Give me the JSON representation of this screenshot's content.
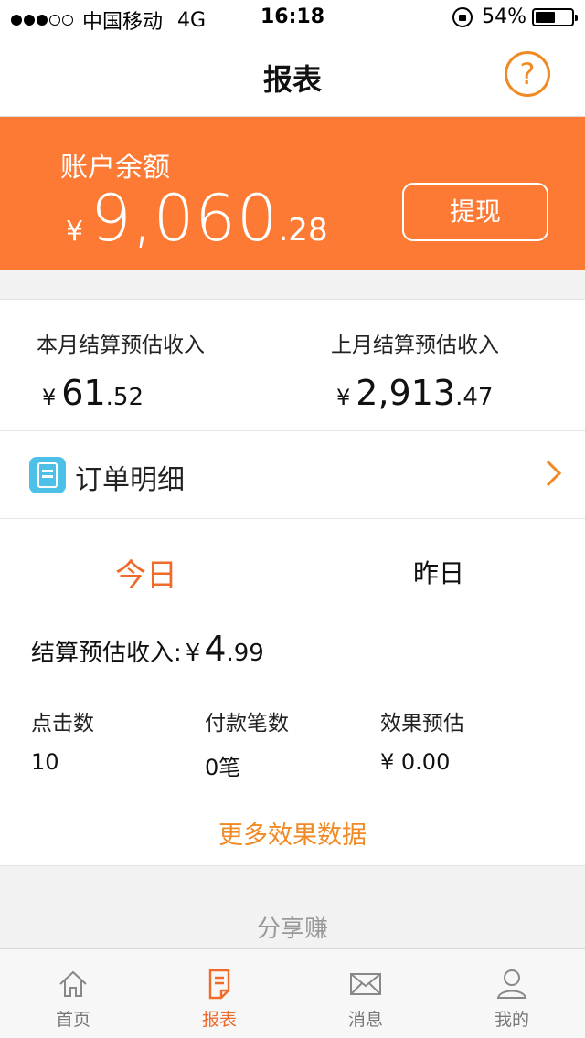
{
  "status_bar": {
    "carrier": "中国移动",
    "network": "4G",
    "time": "16:18",
    "battery": "54%",
    "battery_level": 0.54
  },
  "nav": {
    "title": "报表",
    "help_icon": "question-circle-icon",
    "help_glyph": "?"
  },
  "balance": {
    "label": "账户余额",
    "currency": "¥",
    "integer": "9,060",
    "decimal": ".28",
    "withdraw_label": "提现",
    "bg_color": "#fd7a35"
  },
  "monthly": {
    "current": {
      "title": "本月结算预估收入",
      "currency": "¥",
      "integer": "61",
      "decimal": ".52"
    },
    "previous": {
      "title": "上月结算预估收入",
      "currency": "¥",
      "integer": "2,913",
      "decimal": ".47"
    }
  },
  "order_detail": {
    "label": "订单明细",
    "icon": "document-icon"
  },
  "stats": {
    "tabs": {
      "today": "今日",
      "yesterday": "昨日"
    },
    "settle_label": "结算预估收入:",
    "settle_currency": "¥",
    "settle_integer": "4",
    "settle_decimal": ".99",
    "metrics": [
      {
        "title": "点击数",
        "value": "10"
      },
      {
        "title": "付款笔数",
        "value": "0笔"
      },
      {
        "title": "效果预估",
        "value": "¥ 0.00"
      }
    ],
    "more_link": "更多效果数据"
  },
  "share": {
    "label": "分享赚"
  },
  "tabbar": {
    "items": [
      {
        "label": "首页",
        "icon": "home-icon"
      },
      {
        "label": "报表",
        "icon": "report-icon"
      },
      {
        "label": "消息",
        "icon": "mail-icon"
      },
      {
        "label": "我的",
        "icon": "user-icon"
      }
    ],
    "active_index": 1,
    "accent_color": "#f06a2a"
  }
}
